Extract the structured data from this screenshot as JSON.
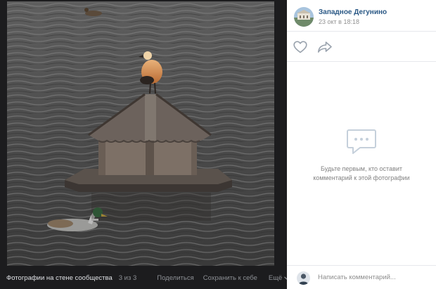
{
  "viewer": {
    "album_title": "Фотографии на стене сообщества",
    "counter": "3 из 3",
    "share_label": "Поделиться",
    "save_label": "Сохранить к себе",
    "more_label": "Ещё"
  },
  "post": {
    "author": "Западное Дегунино",
    "date": "23 окт в 18:18"
  },
  "comments": {
    "empty_text": "Будьте первым, кто оставит комментарий к этой фотографии",
    "input_placeholder": "Написать комментарий..."
  },
  "icons": {
    "like": "heart-icon",
    "share": "share-arrow-icon",
    "empty": "comment-bubble-icon",
    "more": "chevron-down-icon"
  },
  "colors": {
    "viewer_background": "#1c1c1e",
    "link": "#2a5885",
    "icon": "#99a2ad",
    "divider": "#e7e8ec"
  }
}
